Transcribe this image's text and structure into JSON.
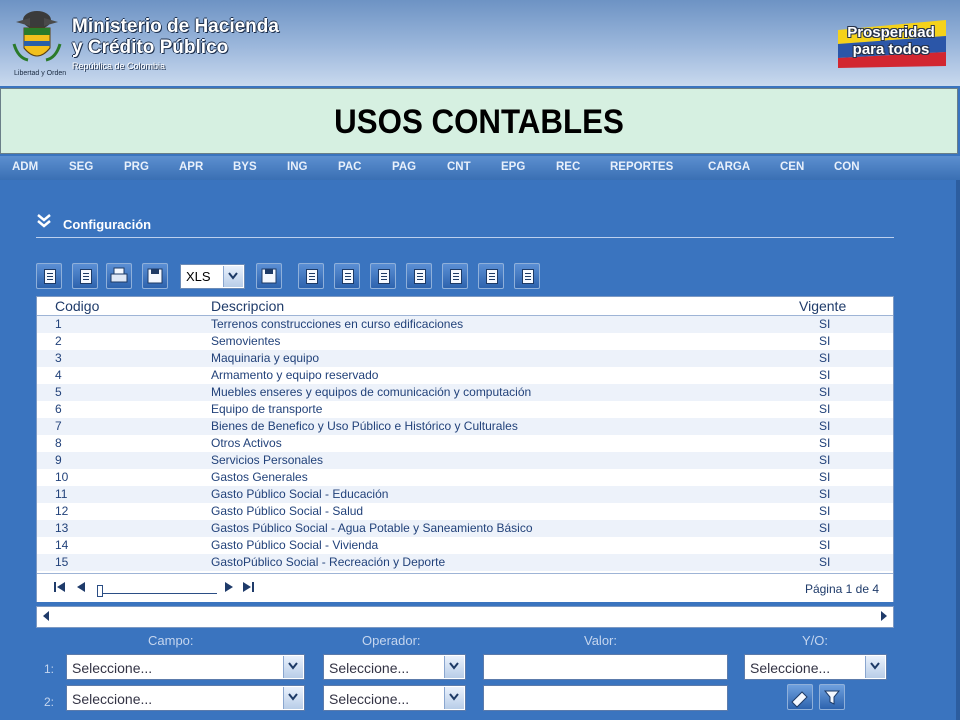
{
  "header": {
    "ministry_line1": "Ministerio de Hacienda",
    "ministry_line2": "y Crédito Público",
    "country": "República de Colombia",
    "motto": "Libertad y Orden",
    "campaign_line1": "Prosperidad",
    "campaign_line2": "para todos"
  },
  "title": "USOS CONTABLES",
  "nav": [
    "ADM",
    "SEG",
    "PRG",
    "APR",
    "BYS",
    "ING",
    "PAC",
    "PAG",
    "CNT",
    "EPG",
    "REC",
    "REPORTES",
    "CARGA",
    "CEN",
    "CON"
  ],
  "section": {
    "label": "Configuración"
  },
  "toolbar": {
    "export_format": "XLS"
  },
  "table": {
    "headers": {
      "code": "Codigo",
      "desc": "Descripcion",
      "active": "Vigente"
    },
    "rows": [
      {
        "code": "1",
        "desc": "Terrenos construcciones en curso edificaciones",
        "active": "SI"
      },
      {
        "code": "2",
        "desc": "Semovientes",
        "active": "SI"
      },
      {
        "code": "3",
        "desc": "Maquinaria y equipo",
        "active": "SI"
      },
      {
        "code": "4",
        "desc": "Armamento y equipo reservado",
        "active": "SI"
      },
      {
        "code": "5",
        "desc": "Muebles enseres y equipos de comunicación y computación",
        "active": "SI"
      },
      {
        "code": "6",
        "desc": "Equipo de transporte",
        "active": "SI"
      },
      {
        "code": "7",
        "desc": "Bienes de Benefico y Uso Público e Histórico y Culturales",
        "active": "SI"
      },
      {
        "code": "8",
        "desc": "Otros Activos",
        "active": "SI"
      },
      {
        "code": "9",
        "desc": "Servicios Personales",
        "active": "SI"
      },
      {
        "code": "10",
        "desc": "Gastos Generales",
        "active": "SI"
      },
      {
        "code": "11",
        "desc": "Gasto Público Social - Educación",
        "active": "SI"
      },
      {
        "code": "12",
        "desc": "Gasto Público Social - Salud",
        "active": "SI"
      },
      {
        "code": "13",
        "desc": "Gastos Público Social - Agua Potable y Saneamiento Básico",
        "active": "SI"
      },
      {
        "code": "14",
        "desc": "Gasto Público Social - Vivienda",
        "active": "SI"
      },
      {
        "code": "15",
        "desc": "GastoPúblico Social - Recreación y Deporte",
        "active": "SI"
      }
    ],
    "page_info": "Página 1 de 4"
  },
  "filter": {
    "label_field": "Campo:",
    "label_operator": "Operador:",
    "label_value": "Valor:",
    "label_andor": "Y/O:",
    "row1_num": "1:",
    "row2_num": "2:",
    "select_placeholder": "Seleccione..."
  }
}
